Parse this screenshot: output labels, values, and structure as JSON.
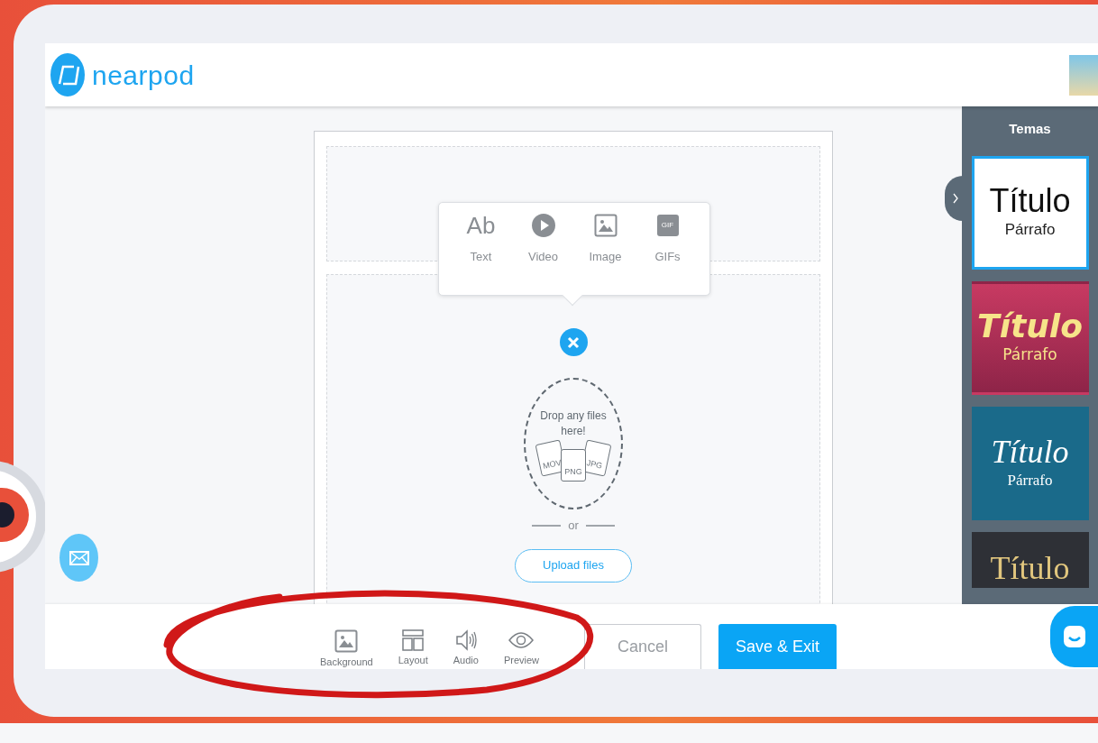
{
  "header": {
    "logo": "nearpod"
  },
  "insert_menu": {
    "options": [
      {
        "label": "Text",
        "kind": "text",
        "glyph": "Ab"
      },
      {
        "label": "Video",
        "kind": "video"
      },
      {
        "label": "Image",
        "kind": "image"
      },
      {
        "label": "GIFs",
        "kind": "gif",
        "glyph": "GIF"
      }
    ]
  },
  "dropzone": {
    "prompt": "Drop any files here!",
    "file_types": [
      "MOV",
      "PNG",
      "JPG"
    ],
    "separator": "or",
    "upload_button": "Upload files"
  },
  "themes_panel": {
    "title": "Temas",
    "themes": [
      {
        "title": "Título",
        "paragraph": "Párrafo",
        "kind": "plain",
        "selected": true
      },
      {
        "title": "Título",
        "paragraph": "Párrafo",
        "kind": "rose",
        "selected": false
      },
      {
        "title": "Título",
        "paragraph": "Párrafo",
        "kind": "teal",
        "selected": false
      },
      {
        "title": "Título",
        "kind": "dark",
        "selected": false
      }
    ]
  },
  "toolbar": [
    {
      "label": "Background",
      "kind": "image"
    },
    {
      "label": "Layout",
      "kind": "layout"
    },
    {
      "label": "Audio",
      "kind": "audio"
    },
    {
      "label": "Preview",
      "kind": "preview"
    }
  ],
  "buttons": {
    "cancel": "Cancel",
    "save": "Save & Exit"
  }
}
